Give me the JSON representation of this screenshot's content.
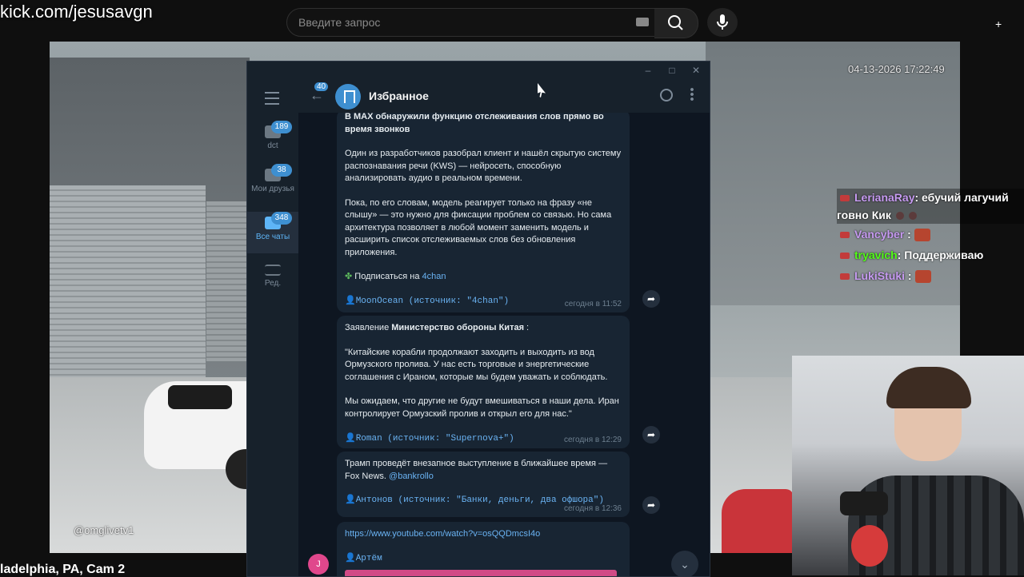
{
  "overlay": {
    "channel_url": "kick.com/jesusavgn"
  },
  "search": {
    "placeholder": "Введите запрос"
  },
  "video": {
    "timestamp": "04-13-2026 17:22:49",
    "watermark": "@omglivetv1",
    "title": "ladelphia, PA, Cam 2"
  },
  "chat_overlay": [
    {
      "user": "LerianaRay",
      "user_color": "#c79bf2",
      "text": ": ебучий лагучий говно Кик"
    },
    {
      "user": "Vancyber",
      "user_color": "#c79bf2",
      "text": " :"
    },
    {
      "user": "tryavich",
      "user_color": "#53fc18",
      "text": ": Поддерживаю"
    },
    {
      "user": "LukiStuki",
      "user_color": "#c79bf2",
      "text": " :"
    }
  ],
  "telegram": {
    "folders": [
      {
        "label": "dct",
        "badge": "189"
      },
      {
        "label": "Мои друзья",
        "badge": "38"
      },
      {
        "label": "Все чаты",
        "badge": "348"
      },
      {
        "label": "Ред.",
        "badge": ""
      }
    ],
    "back_badge": "40",
    "chat_title": "Избранное",
    "messages": [
      {
        "headline": "В MAX обнаружили функцию отслеживания слов прямо во время звонков",
        "p1": "Один из разработчиков разобрал клиент и нашёл скрытую систему распознавания речи (KWS) — нейросеть, способную анализировать аудио в реальном времени.",
        "p2": "Пока, по его словам, модель реагирует только на фразу «не слышу» — это нужно для фиксации проблем со связью. Но сама архитектура позволяет в любой момент заменить модель и расширить список отслеживаемых слов без обновления приложения.",
        "subscribe": "Подписаться на",
        "subscribe_link": "4chan",
        "source": "MoonOcean (источник: \"4chan\")",
        "time": "сегодня в 11:52"
      },
      {
        "intro": "Заявление",
        "intro_bold": "Министерство обороны Китая",
        "intro_end": " :",
        "p1": "\"Китайские корабли продолжают заходить и выходить из вод Ормузского пролива. У нас есть торговые и энергетические соглашения с Ираном, которые мы будем уважать и соблюдать.",
        "p2": "Мы ожидаем, что другие не будут вмешиваться в наши дела. Иран контролирует Ормузский пролив и открыл его для нас.\"",
        "source": "Roman (источник: \"Supernova+\")",
        "time": "сегодня в 12:29"
      },
      {
        "text": "Трамп проведёт внезапное выступление в ближайшее время — Fox News.",
        "mention": "@bankrollo",
        "source": "Антонов (источник: \"Банки, деньги, два офшора\")",
        "time": "сегодня в 12:36"
      },
      {
        "link": "https://www.youtube.com/watch?v=osQQDmcsI4o",
        "author": "Артём",
        "avatar_letter": "J"
      }
    ]
  }
}
